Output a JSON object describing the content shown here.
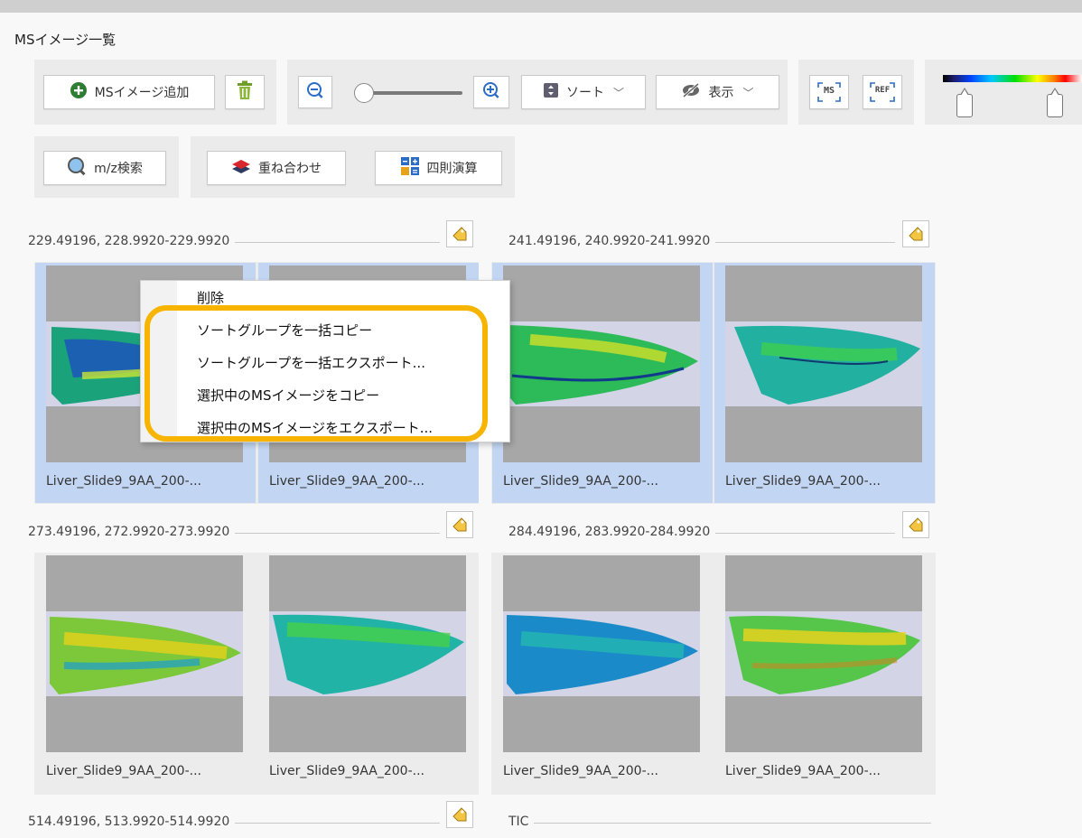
{
  "window": {
    "title": "MSイメージ一覧"
  },
  "toolbar": {
    "add_label": "MSイメージ追加",
    "sort_label": "ソート",
    "view_label": "表示",
    "ms_label": "MS",
    "ref_label": "REF",
    "mz_search_label": "m/z検索",
    "overlay_label": "重ね合わせ",
    "arith_label": "四則演算",
    "zoom_level": 0
  },
  "colors": {
    "accent_orange": "#f7b400",
    "selection": "#c2d6f3",
    "add_green": "#2f7d32"
  },
  "groups": [
    {
      "label": "229.49196, 228.9920-229.9920",
      "tiles": [
        {
          "name": "Liver_Slide9_9AA_200-...",
          "selected": true
        },
        {
          "name": "Liver_Slide9_9AA_200-...",
          "selected": true
        }
      ]
    },
    {
      "label": "241.49196, 240.9920-241.9920",
      "tiles": [
        {
          "name": "Liver_Slide9_9AA_200-...",
          "selected": true
        },
        {
          "name": "Liver_Slide9_9AA_200-...",
          "selected": true
        }
      ]
    },
    {
      "label": "273.49196, 272.9920-273.9920",
      "tiles": [
        {
          "name": "Liver_Slide9_9AA_200-...",
          "selected": false
        },
        {
          "name": "Liver_Slide9_9AA_200-...",
          "selected": false
        }
      ]
    },
    {
      "label": "284.49196, 283.9920-284.9920",
      "tiles": [
        {
          "name": "Liver_Slide9_9AA_200-...",
          "selected": false
        },
        {
          "name": "Liver_Slide9_9AA_200-...",
          "selected": false
        }
      ]
    },
    {
      "label": "514.49196, 513.9920-514.9920",
      "tiles": []
    },
    {
      "label": "TIC",
      "tiles": []
    }
  ],
  "context_menu": {
    "items": [
      {
        "label": "削除"
      },
      {
        "label": "ソートグループを一括コピー"
      },
      {
        "label": "ソートグループを一括エクスポート..."
      },
      {
        "label": "選択中のMSイメージをコピー"
      },
      {
        "label": "選択中のMSイメージをエクスポート..."
      }
    ]
  }
}
